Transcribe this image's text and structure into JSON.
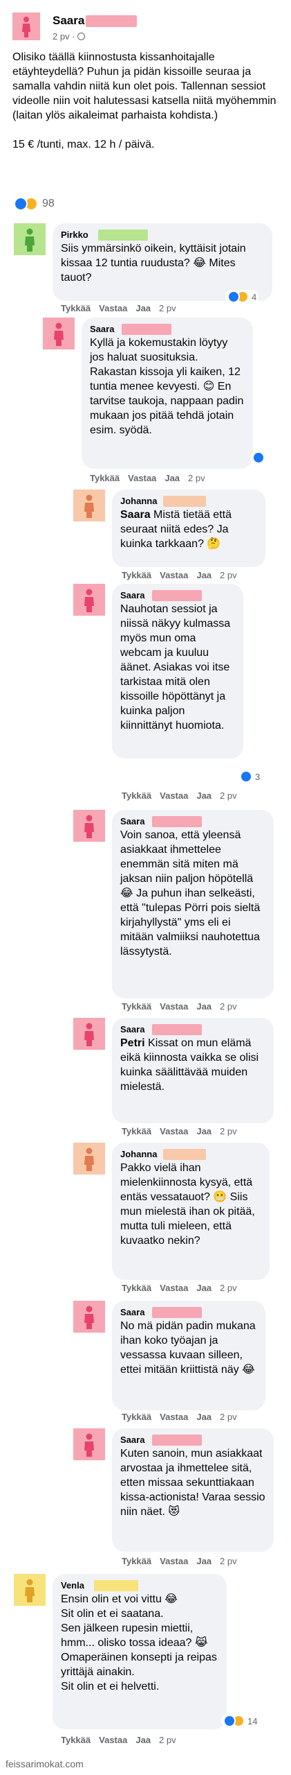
{
  "post": {
    "author": "Saara",
    "meta": "2 pv · ",
    "paragraph1": "Olisiko täällä kiinnostusta kissanhoitajalle etäyhteydellä? Puhun ja pidän kissoille seuraa ja samalla vahdin niitä kun olet pois. Tallennan sessiot videolle niin voit halutessasi katsella niitä myöhemmin (laitan ylös aikaleimat parhaista kohdista.)",
    "paragraph2": "15 € /tunti, max. 12 h / päivä.",
    "reaction_count": "98"
  },
  "comments": [
    {
      "name": "Pirkko",
      "text": "Siis ymmärsinkö oikein, kyttäisit jotain kissaa 12 tuntia ruudusta? 😂 Mites tauot?",
      "like": "Tykkää",
      "reply": "Vastaa",
      "share": "Jaa",
      "time": "2 pv",
      "reactions": "4"
    },
    {
      "name": "Saara",
      "text": "Kyllä ja kokemustakin löytyy jos haluat suosituksia. Rakastan kissoja yli kaiken, 12 tuntia menee kevyesti. 😊 En tarvitse taukoja, nappaan padin mukaan jos pitää tehdä jotain esim. syödä.",
      "like": "Tykkää",
      "reply": "Vastaa",
      "share": "Jaa",
      "time": "2 pv"
    },
    {
      "name": "Johanna",
      "tag": "Saara",
      "text": " Mistä tietää että seuraat niitä edes? Ja kuinka tarkkaan? 🤔",
      "like": "Tykkää",
      "reply": "Vastaa",
      "share": "Jaa",
      "time": "2 pv"
    },
    {
      "name": "Saara",
      "text": "Nauhotan sessiot ja niissä näkyy kulmassa myös mun oma webcam ja kuuluu äänet. Asiakas voi itse tarkistaa mitä olen kissoille höpöttänyt ja kuinka paljon kiinnittänyt huomiota.",
      "like": "Tykkää",
      "reply": "Vastaa",
      "share": "Jaa",
      "time": "2 pv",
      "reactions": "3"
    },
    {
      "name": "Saara",
      "text": "Voin sanoa, että yleensä asiakkaat ihmettelee enemmän sitä miten mä jaksan niin paljon höpötellä 😂 Ja puhun ihan selkeästi, että \"tulepas Pörri pois sieltä kirjahyllystä\" yms eli ei mitään valmiiksi nauhotettua lässytystä.",
      "like": "Tykkää",
      "reply": "Vastaa",
      "share": "Jaa",
      "time": "2 pv"
    },
    {
      "name": "Saara",
      "tag": "Petri",
      "text": " Kissat on mun elämä eikä kiinnosta vaikka se olisi kuinka säälittävää muiden mielestä.",
      "like": "Tykkää",
      "reply": "Vastaa",
      "share": "Jaa",
      "time": "2 pv"
    },
    {
      "name": "Johanna",
      "text": "Pakko vielä ihan mielenkiinnosta kysyä, että entäs vessatauot? 😬 Siis mun mielestä ihan ok pitää, mutta tuli mieleen, että kuvaatko nekin?",
      "like": "Tykkää",
      "reply": "Vastaa",
      "share": "Jaa",
      "time": "2 pv"
    },
    {
      "name": "Saara",
      "text": "No mä pidän padin mukana ihan koko työajan ja vessassa kuvaan silleen, ettei mitään kriittistä näy 😂",
      "like": "Tykkää",
      "reply": "Vastaa",
      "share": "Jaa",
      "time": "2 pv"
    },
    {
      "name": "Saara",
      "text": "Kuten sanoin, mun asiakkaat arvostaa ja ihmettelee sitä, etten missaa sekunttiakaan kissa-actionista! Varaa sessio niin näet. 😻",
      "like": "Tykkää",
      "reply": "Vastaa",
      "share": "Jaa",
      "time": "2 pv"
    },
    {
      "name": "Venla",
      "text_lines": [
        "Ensin olin et voi vittu 😂",
        "Sit olin et ei saatana.",
        "Sen jälkeen rupesin miettii, hmm... olisko tossa ideaa? 😹",
        "Omaperäinen konsepti ja reipas yrittäjä ainakin.",
        "Sit olin et ei helvetti."
      ],
      "like": "Tykkää",
      "reply": "Vastaa",
      "share": "Jaa",
      "time": "2 pv",
      "reactions": "14"
    }
  ],
  "footer": "feissarimokat.com",
  "colors": {
    "avatar_pink_bg": "#f7a6b4",
    "avatar_pink_fig": "#e8436b",
    "avatar_green_bg": "#b7e58f",
    "avatar_green_fig": "#4ca63a",
    "avatar_peach_bg": "#f8c9a8",
    "avatar_peach_fig": "#e07b52",
    "avatar_yellow_bg": "#f7e37a",
    "avatar_yellow_fig": "#e0a12a",
    "bubble": "#f0f2f5",
    "meta_text": "#65676b",
    "like_blue": "#1877f2"
  }
}
